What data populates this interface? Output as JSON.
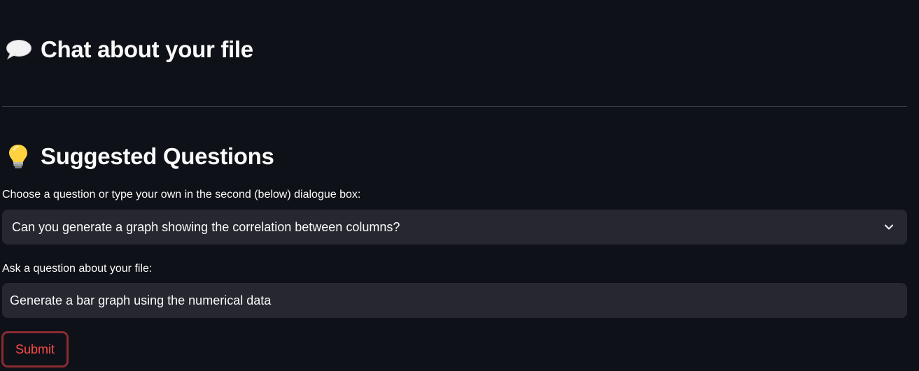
{
  "chat_header": {
    "icon": "speech-bubble-icon",
    "title": "Chat about your file"
  },
  "suggested": {
    "icon": "light-bulb-icon",
    "title": "Suggested Questions"
  },
  "question_select": {
    "label": "Choose a question or type your own in the second (below) dialogue box:",
    "selected_value": "Can you generate a graph showing the correlation between columns?"
  },
  "question_input": {
    "label": "Ask a question about your file:",
    "value": "Generate a bar graph using the numerical data"
  },
  "submit_button": {
    "label": "Submit"
  },
  "colors": {
    "background": "#0e1117",
    "input_background": "#262730",
    "accent": "#ff4b4b",
    "text": "#fafafa"
  }
}
